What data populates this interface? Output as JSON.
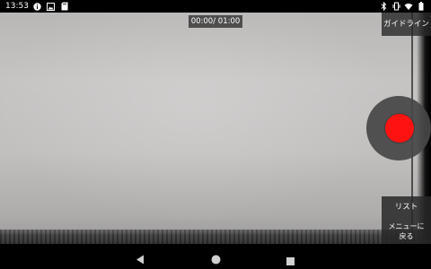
{
  "status_bar": {
    "time": "13:53",
    "left_icons": [
      "info-icon",
      "image-icon",
      "sd-card-icon"
    ],
    "right_icons": [
      "bluetooth-icon",
      "vibrate-icon",
      "wifi-icon",
      "battery-icon"
    ]
  },
  "preview": {
    "timer": "00:00/ 01:00"
  },
  "controls": {
    "guide_label": "ガイドライン",
    "record_color": "#ff1212",
    "list_label": "リスト",
    "menu_label": "メニューに\n戻る"
  },
  "navigation": {
    "icons": [
      "back-icon",
      "home-icon",
      "recent-apps-icon"
    ]
  }
}
